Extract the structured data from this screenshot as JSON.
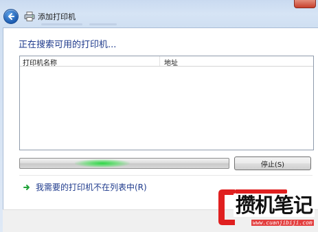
{
  "window": {
    "title": "添加打印机"
  },
  "main": {
    "heading": "正在搜索可用的打印机...",
    "table": {
      "columns": [
        "打印机名称",
        "地址"
      ],
      "rows": []
    },
    "progress": {
      "state": "indeterminate"
    },
    "stop_label": "停止(S)",
    "not_listed_link": "我需要的打印机不在列表中(R)"
  },
  "watermark": {
    "title": "攒机笔记",
    "url": "www.cuanjibiji.com"
  },
  "colors": {
    "heading_text": "#1e3a8c",
    "link_arrow": "#21a33a",
    "progress_glow": "#2ed646",
    "watermark_red": "#e02020"
  },
  "icons": {
    "back": "back-arrow-icon",
    "printer": "printer-icon",
    "link": "green-arrow-icon"
  }
}
